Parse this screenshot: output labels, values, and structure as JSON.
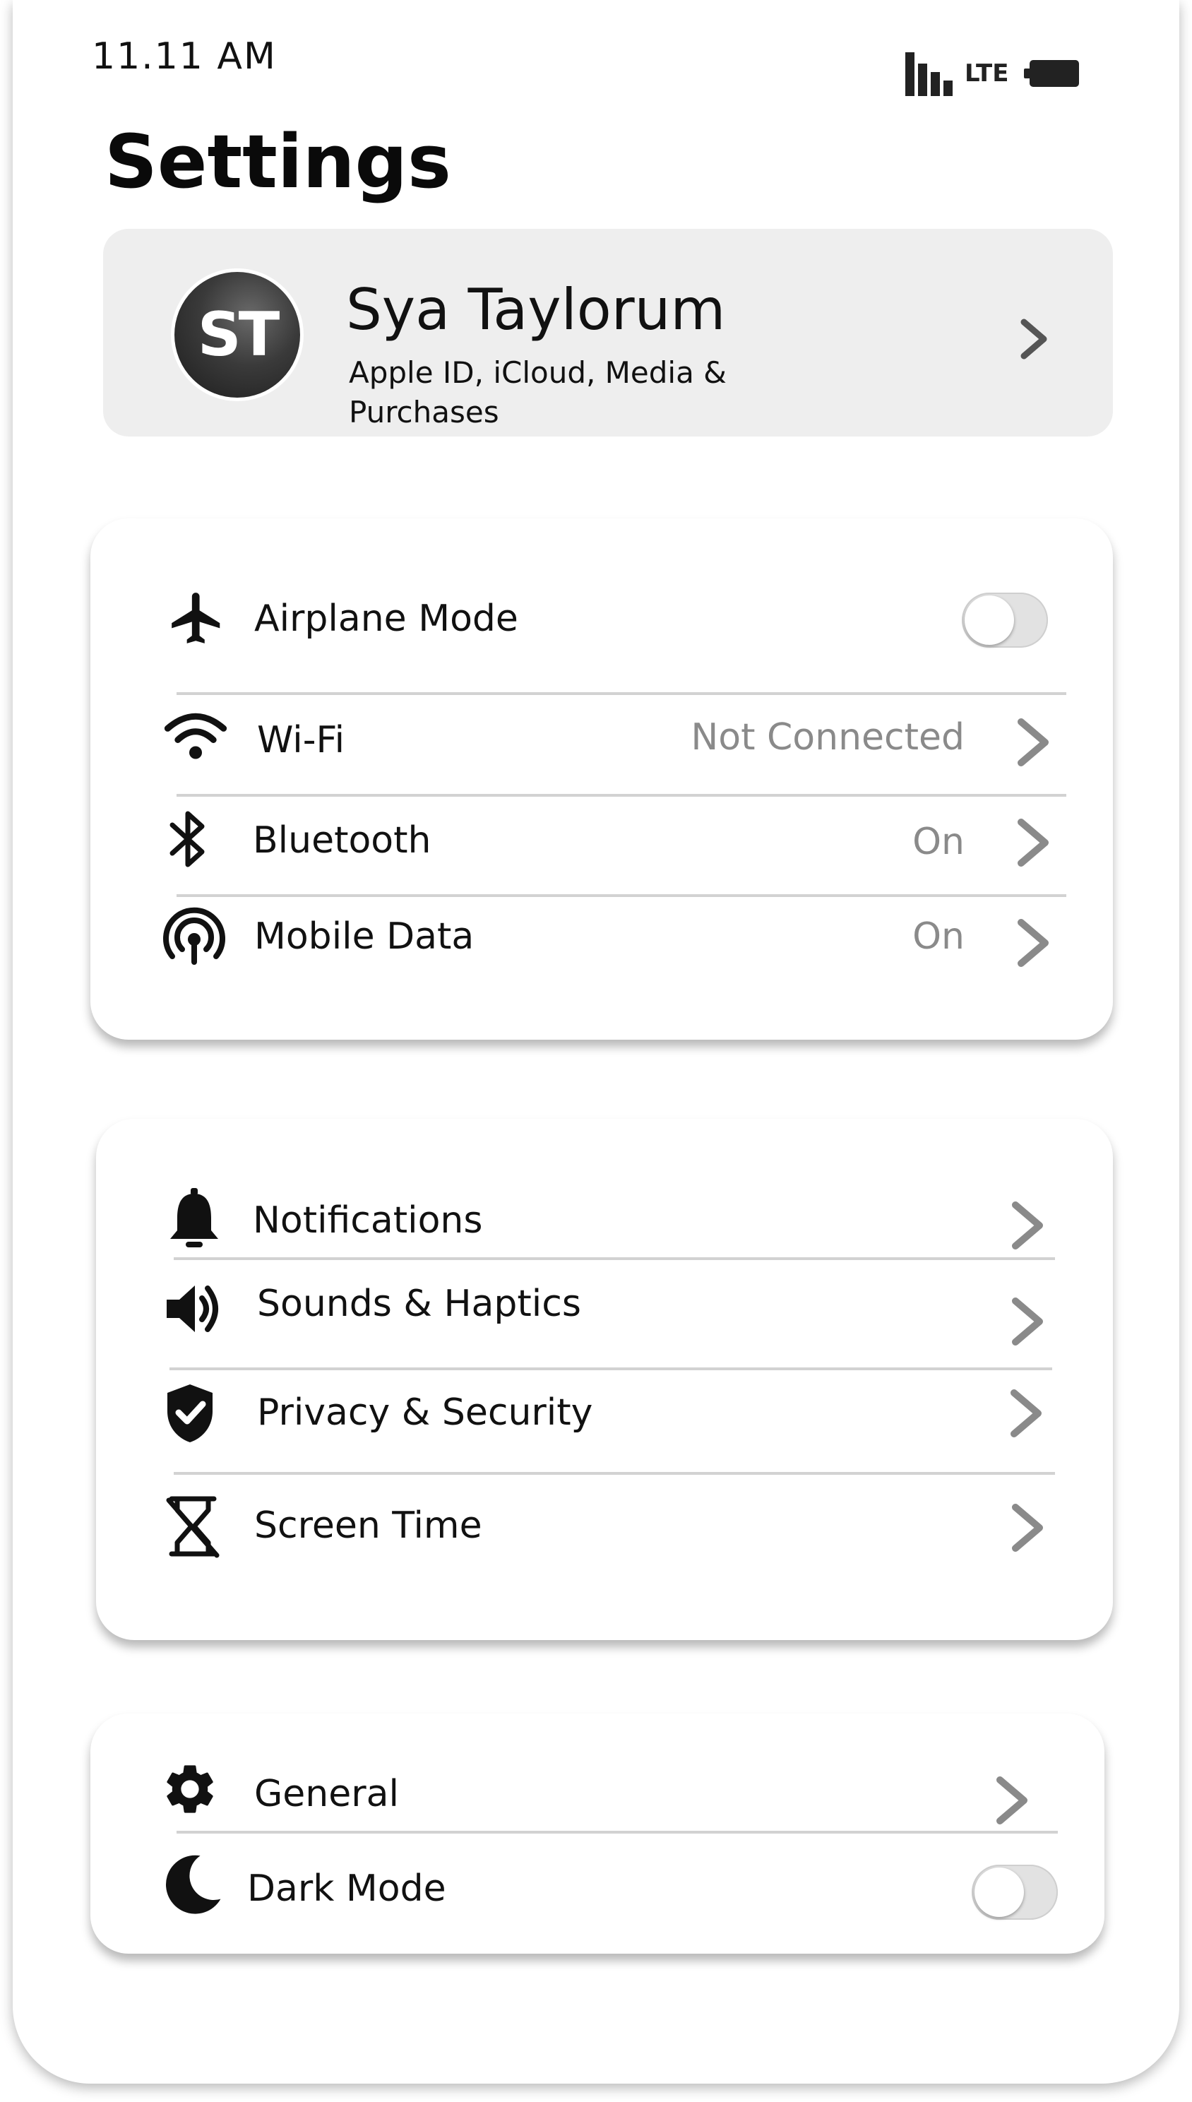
{
  "status_bar": {
    "time": "11.11 AM",
    "network": "LTE"
  },
  "page": {
    "title": "Settings"
  },
  "profile": {
    "initials": "ST",
    "name": "Sya Taylorum",
    "subtitle": "Apple ID, iCloud, Media & Purchases"
  },
  "connectivity": {
    "airplane_mode": {
      "label": "Airplane Mode",
      "icon": "airplane-icon",
      "enabled": false
    },
    "wifi": {
      "label": "Wi-Fi",
      "value": "Not Connected",
      "icon": "wifi-icon"
    },
    "bluetooth": {
      "label": "Bluetooth",
      "value": "On",
      "icon": "bluetooth-icon"
    },
    "mobile_data": {
      "label": "Mobile Data",
      "value": "On",
      "icon": "antenna-icon"
    }
  },
  "system": {
    "notifications": {
      "label": "Notifications",
      "icon": "bell-icon"
    },
    "sounds": {
      "label": "Sounds & Haptics",
      "icon": "speaker-icon"
    },
    "privacy": {
      "label": "Privacy & Security",
      "icon": "shield-check-icon"
    },
    "screen_time": {
      "label": "Screen Time",
      "icon": "hourglass-icon"
    }
  },
  "general_section": {
    "general": {
      "label": "General",
      "icon": "gear-icon"
    },
    "dark_mode": {
      "label": "Dark Mode",
      "icon": "moon-icon",
      "enabled": false
    }
  },
  "colors": {
    "background": "#ffffff",
    "profile_card": "#eeeeee",
    "value_text": "#8a8a8a",
    "chevron": "#8a8a8a",
    "divider": "#d2d2d2",
    "toggle_off": "#e2e2e2"
  }
}
